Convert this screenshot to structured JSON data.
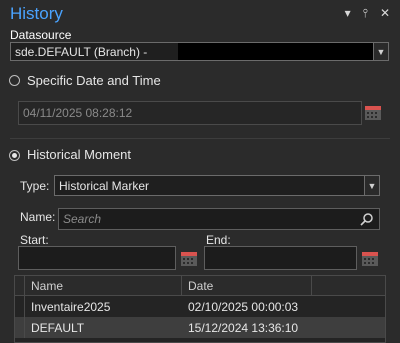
{
  "panel": {
    "title": "History",
    "title_icons": [
      "chevron-down-icon",
      "pin-icon",
      "close-icon"
    ]
  },
  "datasource": {
    "label": "Datasource",
    "value": "sde.DEFAULT (Branch) -"
  },
  "specific": {
    "label": "Specific Date and Time",
    "selected": false,
    "value": "04/11/2025 08:28:12"
  },
  "historical": {
    "label": "Historical Moment",
    "selected": true,
    "type_label": "Type:",
    "type_value": "Historical Marker",
    "name_label": "Name:",
    "search_placeholder": "Search",
    "start_label": "Start:",
    "end_label": "End:",
    "start_value": "",
    "end_value": ""
  },
  "table": {
    "columns": [
      "Name",
      "Date"
    ],
    "rows": [
      {
        "name": "Inventaire2025",
        "date": "02/10/2025 00:00:03",
        "selected": false
      },
      {
        "name": "DEFAULT",
        "date": "15/12/2024 13:36:10",
        "selected": true
      }
    ]
  },
  "colors": {
    "background": "#2b2b2b",
    "title": "#4aa3ff",
    "calendar_accent": "#d9534f"
  }
}
